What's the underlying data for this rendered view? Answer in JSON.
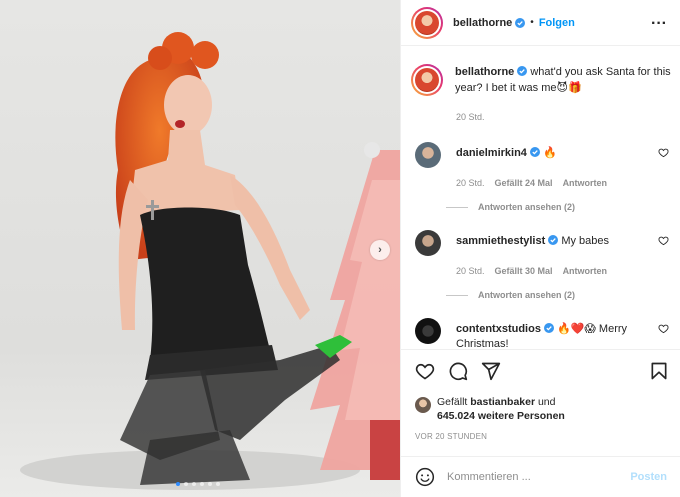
{
  "colors": {
    "link_blue": "#0095f6",
    "post_button_disabled": "#b2dffc",
    "muted_text": "#8e8e8e",
    "verified_badge": "#3897f0",
    "like_red": "#ed4956"
  },
  "header": {
    "username": "bellathorne",
    "separator": "•",
    "follow_label": "Folgen",
    "more_icon": "more-dots-icon"
  },
  "caption": {
    "username": "bellathorne",
    "text": " what'd you ask Santa for this year? I bet it was me😈🎁",
    "time": "20 Std."
  },
  "comments": [
    {
      "username": "danielmirkin4",
      "text": " 🔥",
      "time": "20 Std.",
      "likes": "Gefällt 24 Mal",
      "reply_label": "Antworten",
      "view_replies": "Antworten ansehen (2)"
    },
    {
      "username": "sammiethestylist",
      "text": " My babes",
      "time": "20 Std.",
      "likes": "Gefällt 30 Mal",
      "reply_label": "Antworten",
      "view_replies": "Antworten ansehen (2)"
    },
    {
      "username": "contentxstudios",
      "text": " 🔥❤️😱 Merry Christmas!"
    }
  ],
  "likes": {
    "prefix": "Gefällt ",
    "first_user": "bastianbaker",
    "middle": " und",
    "count_text": "645.024 weitere Personen"
  },
  "posted_ago": "VOR 20 STUNDEN",
  "add_comment": {
    "placeholder": "Kommentieren ...",
    "post_label": "Posten",
    "emoji_icon": "smiley-icon"
  },
  "carousel": {
    "slide_count": 6,
    "active_index": 0,
    "next_icon": "chevron-right-icon"
  }
}
